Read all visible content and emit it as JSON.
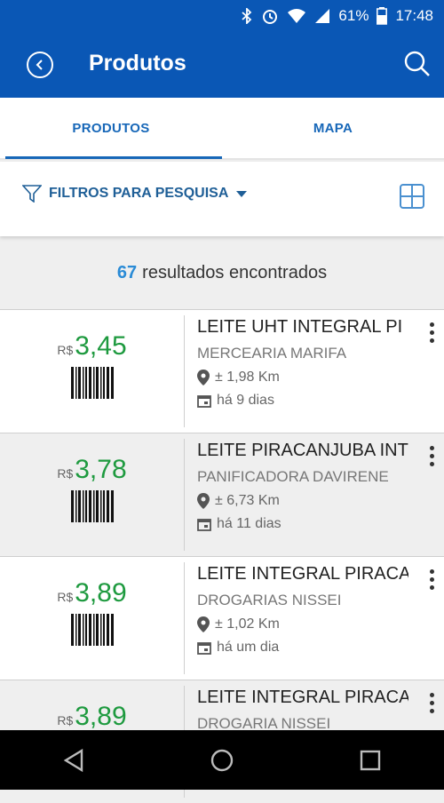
{
  "status": {
    "battery": "61%",
    "time": "17:48"
  },
  "appbar": {
    "title": "Produtos"
  },
  "tabs": [
    {
      "label": "PRODUTOS",
      "active": true
    },
    {
      "label": "MAPA",
      "active": false
    }
  ],
  "filter": {
    "label": "FILTROS PARA PESQUISA"
  },
  "results": {
    "count": "67",
    "label": "resultados encontrados"
  },
  "items": [
    {
      "currency": "R$",
      "price": "3,45",
      "name": "LEITE UHT INTEGRAL PI",
      "store": "MERCEARIA MARIFA",
      "distance": "± 1,98 Km",
      "age": "há 9 dias"
    },
    {
      "currency": "R$",
      "price": "3,78",
      "name": "LEITE PIRACANJUBA INT",
      "store": "PANIFICADORA DAVIRENE",
      "distance": "± 6,73 Km",
      "age": "há 11 dias"
    },
    {
      "currency": "R$",
      "price": "3,89",
      "name": "LEITE INTEGRAL PIRACA",
      "store": "DROGARIAS NISSEI",
      "distance": "± 1,02 Km",
      "age": "há um dia"
    },
    {
      "currency": "R$",
      "price": "3,89",
      "name": "LEITE INTEGRAL PIRACA",
      "store": "DROGARIA NISSEI",
      "distance": "",
      "age": ""
    }
  ],
  "colors": {
    "primary": "#0a57b5",
    "price": "#1e9a3f",
    "count": "#2a8bd6"
  }
}
